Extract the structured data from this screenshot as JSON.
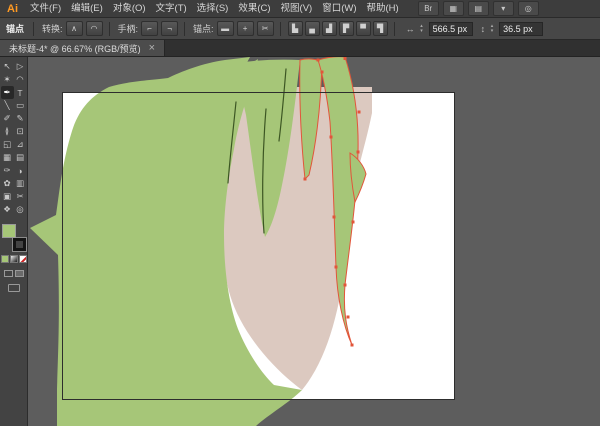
{
  "app": {
    "logo": "Ai",
    "menubar": {
      "items": [
        "文件(F)",
        "编辑(E)",
        "对象(O)",
        "文字(T)",
        "选择(S)",
        "效果(C)",
        "视图(V)",
        "窗口(W)",
        "帮助(H)"
      ],
      "right_icons": [
        {
          "name": "bridge-button",
          "glyph": "Br"
        },
        {
          "name": "stock-button",
          "glyph": "▦"
        },
        {
          "name": "arrange-documents-button",
          "glyph": "▤"
        },
        {
          "name": "arrange-documents-arrow",
          "glyph": "▾"
        },
        {
          "name": "cs-live-button",
          "glyph": "◎"
        }
      ]
    }
  },
  "control_bar": {
    "context_label": "锚点",
    "groups": [
      {
        "label": "转换:",
        "buttons": [
          {
            "name": "convert-to-corner-button",
            "glyph": "∧"
          },
          {
            "name": "convert-to-smooth-button",
            "glyph": "◠"
          }
        ]
      },
      {
        "label": "手柄:",
        "buttons": [
          {
            "name": "show-handles-button",
            "glyph": "⌐"
          },
          {
            "name": "hide-handles-button",
            "glyph": "¬"
          }
        ]
      },
      {
        "label": "锚点:",
        "buttons": [
          {
            "name": "remove-anchor-button",
            "glyph": "▬"
          },
          {
            "name": "add-anchor-button",
            "glyph": "+"
          },
          {
            "name": "cut-path-button",
            "glyph": "✂"
          }
        ]
      }
    ],
    "align_buttons": [
      {
        "name": "align-horizontal-left-button",
        "glyph": "▙"
      },
      {
        "name": "align-horizontal-center-button",
        "glyph": "▄"
      },
      {
        "name": "align-horizontal-right-button",
        "glyph": "▟"
      },
      {
        "name": "align-vertical-top-button",
        "glyph": "▛"
      },
      {
        "name": "align-vertical-middle-button",
        "glyph": "▀"
      },
      {
        "name": "align-vertical-bottom-button",
        "glyph": "▜"
      }
    ],
    "x_field": {
      "icon": "↔",
      "value": "566.5 px"
    },
    "y_field": {
      "icon": "↕",
      "value": "36.5 px"
    }
  },
  "document_tab": {
    "title": "未标题-4* @ 66.67% (RGB/预览)",
    "close_glyph": "×"
  },
  "toolbar": {
    "tools": [
      {
        "name": "selection-tool",
        "glyph": "↖"
      },
      {
        "name": "direct-selection-tool",
        "glyph": "▷"
      },
      {
        "name": "magic-wand-tool",
        "glyph": "✶"
      },
      {
        "name": "lasso-tool",
        "glyph": "◠"
      },
      {
        "name": "pen-tool",
        "glyph": "✒",
        "active": true
      },
      {
        "name": "type-tool",
        "glyph": "T"
      },
      {
        "name": "line-segment-tool",
        "glyph": "╲"
      },
      {
        "name": "rectangle-tool",
        "glyph": "▭"
      },
      {
        "name": "paintbrush-tool",
        "glyph": "✐"
      },
      {
        "name": "pencil-tool",
        "glyph": "✎"
      },
      {
        "name": "width-tool",
        "glyph": "≬"
      },
      {
        "name": "free-transform-tool",
        "glyph": "⊡"
      },
      {
        "name": "shape-builder-tool",
        "glyph": "◱"
      },
      {
        "name": "perspective-grid-tool",
        "glyph": "⊿"
      },
      {
        "name": "mesh-tool",
        "glyph": "▦"
      },
      {
        "name": "gradient-tool",
        "glyph": "▤"
      },
      {
        "name": "eyedropper-tool",
        "glyph": "✑"
      },
      {
        "name": "blend-tool",
        "glyph": "◑"
      },
      {
        "name": "symbol-sprayer-tool",
        "glyph": "✿"
      },
      {
        "name": "column-graph-tool",
        "glyph": "▥"
      },
      {
        "name": "artboard-tool",
        "glyph": "▣"
      },
      {
        "name": "slice-tool",
        "glyph": "✂"
      },
      {
        "name": "hand-tool",
        "glyph": "❖"
      },
      {
        "name": "zoom-tool",
        "glyph": "◎"
      }
    ]
  },
  "artwork": {
    "colors": {
      "green": "#a6c678",
      "skin": "#dcc9c0",
      "selection": "#e2553a",
      "line": "#3c5623",
      "canvas": "#5d5d5d",
      "artboard": "#ffffff"
    },
    "zoom_percent": "66.67%"
  }
}
